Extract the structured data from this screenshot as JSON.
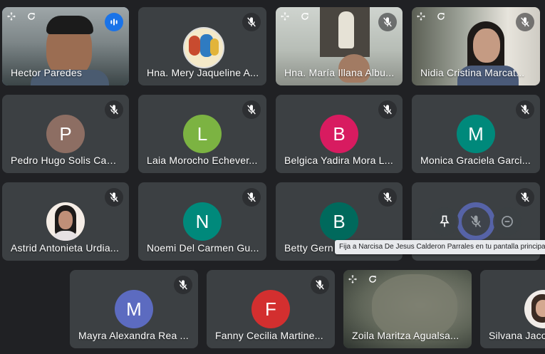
{
  "participants": {
    "hector": "Hector Paredes",
    "mery": "Hna. Mery Jaqueline A...",
    "maria": "Hna. María Illana Albu...",
    "nidia": "Nidia Cristina Marcat...",
    "pedro": {
      "name": "Pedro Hugo Solis Cam...",
      "initial": "P"
    },
    "laia": {
      "name": "Laia Morocho Echever...",
      "initial": "L"
    },
    "belgica": {
      "name": "Belgica Yadira Mora L...",
      "initial": "B"
    },
    "monica": {
      "name": "Monica Graciela Garci...",
      "initial": "M"
    },
    "astrid": "Astrid Antonieta Urdia...",
    "noemi": {
      "name": "Noemi Del Carmen Gu...",
      "initial": "N"
    },
    "betty": {
      "name": "Betty Gern",
      "initial": "B"
    },
    "mayra": {
      "name": "Mayra Alexandra Rea ...",
      "initial": "M"
    },
    "fanny": {
      "name": "Fanny Cecilia Martine...",
      "initial": "F"
    },
    "zoila": "Zoila Maritza Agualsa...",
    "silvana": "Silvana Jaco"
  },
  "tooltip": "Fija a Narcisa De Jesus Calderon Parrales en tu pantalla principal",
  "colors": {
    "pedro": "#8d6e63",
    "laia": "#7cb342",
    "belgica": "#d81b60",
    "monica": "#00897b",
    "noemi": "#00897b",
    "betty": "#00695c",
    "mayra": "#5c6bc0",
    "fanny": "#d32f2f",
    "accent": "#1a73e8",
    "highlight": "#8ab4f8"
  },
  "icons": [
    "mic-off-icon",
    "move-icon",
    "refresh-icon",
    "speaking-indicator-icon",
    "pin-icon",
    "remove-icon"
  ]
}
